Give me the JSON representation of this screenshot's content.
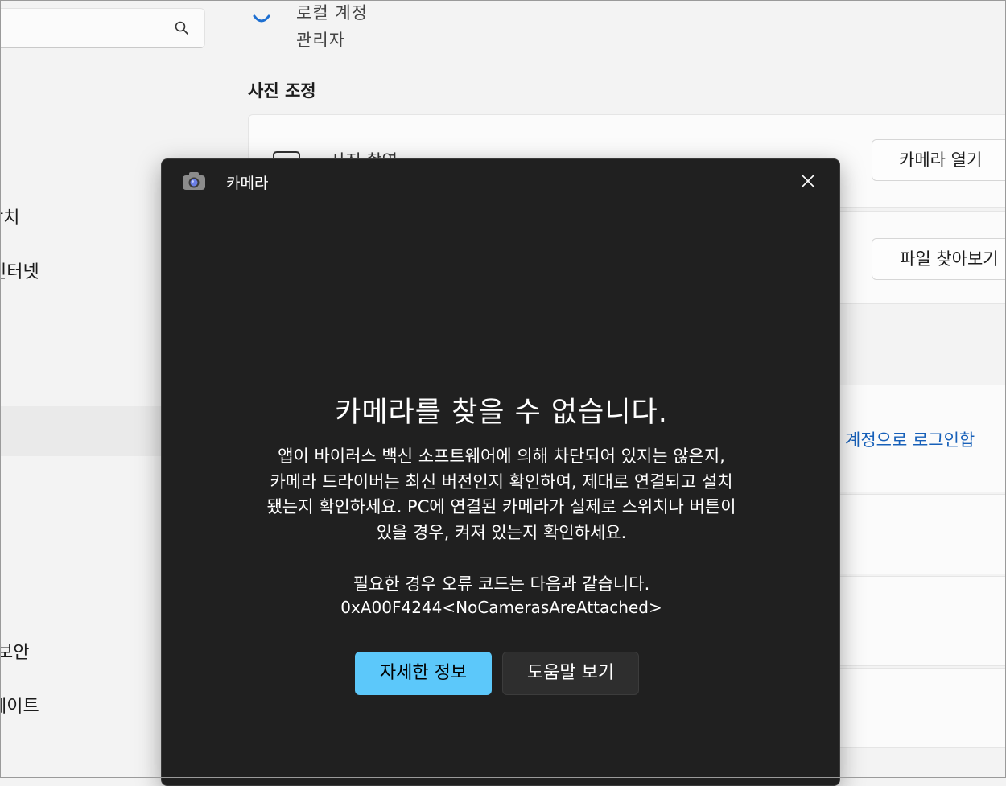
{
  "sidebar": {
    "search": {
      "placeholder": ""
    },
    "items": [
      {
        "label": "장치"
      },
      {
        "label": "인터넷"
      },
      {
        "label": "보안"
      },
      {
        "label": "케이트"
      }
    ]
  },
  "account": {
    "type": "로컬 계정",
    "role": "관리자"
  },
  "photo_section": {
    "title": "사진 조정",
    "take_photo_label": "사진 촬영",
    "open_camera_button": "카메라 열기",
    "browse_files_button": "파일 찾아보기",
    "sign_in_link": "계정으로 로그인합"
  },
  "dialog": {
    "app_title": "카메라",
    "error_title": "카메라를 찾을 수 없습니다.",
    "error_lines": [
      "앱이 바이러스 백신 소프트웨어에 의해 차단되어 있지는 않은지,",
      "카메라 드라이버는 최신 버전인지 확인하여, 제대로 연결되고 설치",
      "됐는지 확인하세요. PC에 연결된 카메라가 실제로 스위치나 버튼이",
      "있을 경우, 켜져 있는지 확인하세요."
    ],
    "error_code_label": "필요한 경우 오류 코드는 다음과 같습니다.",
    "error_code": "0xA00F4244<NoCamerasAreAttached>",
    "more_info_button": "자세한 정보",
    "help_button": "도움말 보기"
  },
  "colors": {
    "accent": "#5cc8fa",
    "link": "#1760b9",
    "dialog_bg": "#202020"
  }
}
